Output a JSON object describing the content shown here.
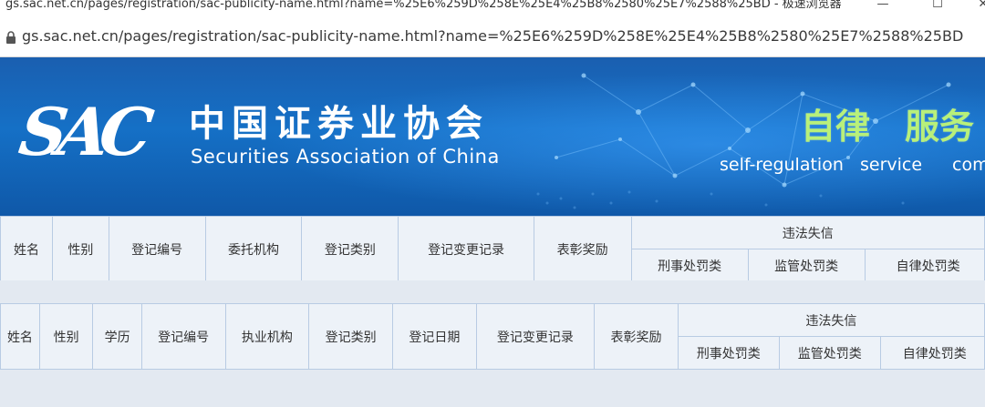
{
  "window": {
    "title": "gs.sac.net.cn/pages/registration/sac-publicity-name.html?name=%25E6%259D%258E%25E4%25B8%2580%25E7%2588%25BD - 极速浏览器",
    "minimize_glyph": "—",
    "maximize_glyph": "☐",
    "close_glyph": "✕"
  },
  "address_bar": {
    "url": "gs.sac.net.cn/pages/registration/sac-publicity-name.html?name=%25E6%259D%258E%25E4%25B8%2580%25E7%2588%25BD"
  },
  "banner": {
    "logo_text": "SAC",
    "org_name_cn": "中国证券业协会",
    "org_name_en": "Securities Association of China",
    "slogans": [
      {
        "cn": "自律",
        "en": "self-regulation"
      },
      {
        "cn": "服务",
        "en": "service"
      },
      {
        "cn": "",
        "en": "com"
      }
    ]
  },
  "table1": {
    "headers": [
      "姓名",
      "性别",
      "登记编号",
      "委托机构",
      "登记类别",
      "登记变更记录",
      "表彰奖励"
    ],
    "group_header": "违法失信",
    "sub_headers": [
      "刑事处罚类",
      "监管处罚类",
      "自律处罚类"
    ]
  },
  "table2": {
    "headers": [
      "姓名",
      "性别",
      "学历",
      "登记编号",
      "执业机构",
      "登记类别",
      "登记日期",
      "登记变更记录",
      "表彰奖励"
    ],
    "group_header": "违法失信",
    "sub_headers": [
      "刑事处罚类",
      "监管处罚类",
      "自律处罚类"
    ]
  },
  "colors": {
    "banner_blue": "#1570c6",
    "slogan_green": "#b8f07a",
    "table_bg": "#edf2f8",
    "table_border": "#b8cbe3"
  }
}
